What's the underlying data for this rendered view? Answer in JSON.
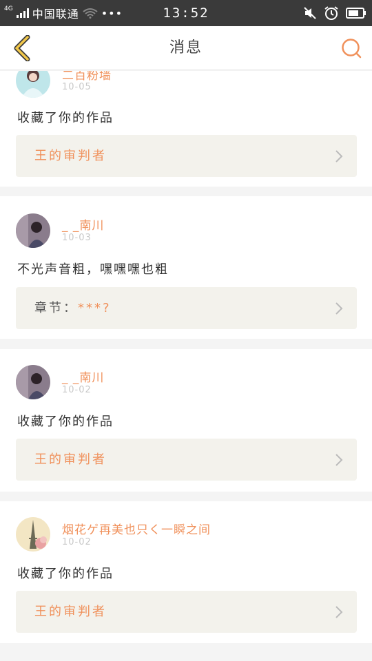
{
  "status_bar": {
    "network": "4G",
    "carrier": "中国联通",
    "more": "•••",
    "time": "13:52"
  },
  "navbar": {
    "title": "消息",
    "accent_color": "#f0905a"
  },
  "messages": [
    {
      "username": "二百粉墙",
      "time": "10-05",
      "text": "收藏了你的作品",
      "ref_prefix": "",
      "ref_text": "王的审判者"
    },
    {
      "username": "_ _南川",
      "time": "10-03",
      "text": "不光声音粗，嘿嘿嘿也粗",
      "ref_prefix": "章节：",
      "ref_text": "***?"
    },
    {
      "username": "_ _南川",
      "time": "10-02",
      "text": "收藏了你的作品",
      "ref_prefix": "",
      "ref_text": "王的审判者"
    },
    {
      "username": "烟花ゲ再美也只く一瞬之间",
      "time": "10-02",
      "text": "收藏了你的作品",
      "ref_prefix": "",
      "ref_text": "王的审判者"
    }
  ]
}
